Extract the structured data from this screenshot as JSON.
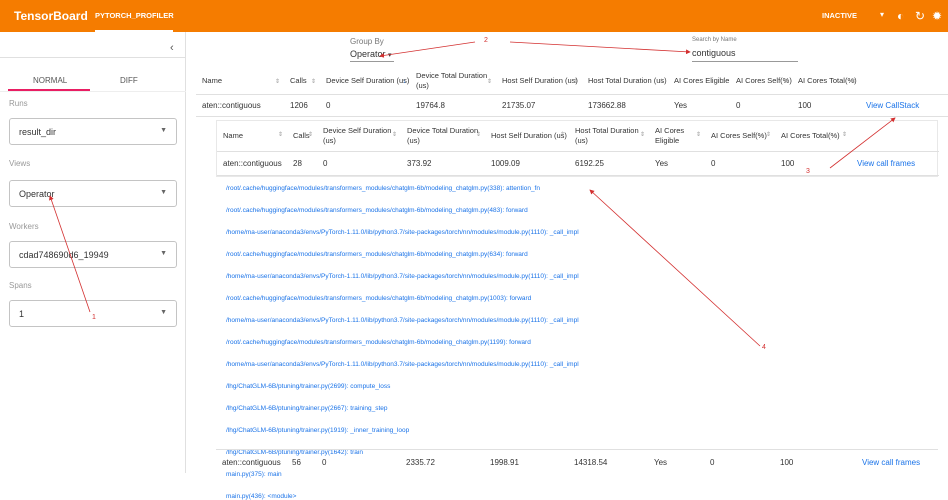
{
  "topbar": {
    "brand": "TensorBoard",
    "active_tab": "PYTORCH_PROFILER",
    "status": "INACTIVE",
    "icons": [
      "dropdown-caret-icon",
      "theme-toggle-icon",
      "refresh-icon",
      "settings-icon"
    ],
    "accent_color": "#f57c00"
  },
  "sidebar": {
    "modes": [
      "NORMAL",
      "DIFF"
    ],
    "runs_label": "Runs",
    "run_value": "result_dir",
    "views_label": "Views",
    "view_value": "Operator",
    "workers_label": "Workers",
    "worker_value": "cdad748690d6_19949",
    "spans_label": "Spans",
    "span_value": "1"
  },
  "toolbar": {
    "group_by_label": "Group By",
    "group_by_value": "Operator",
    "search_label": "Search by Name",
    "search_value": "contiguous"
  },
  "table": {
    "headers": [
      "Name",
      "Calls",
      "Device Self Duration (us)",
      "Device Total Duration (us)",
      "Host Self Duration (us)",
      "Host Total Duration (us)",
      "AI Cores Eligible",
      "AI Cores Self(%)",
      "AI Cores Total(%)"
    ],
    "row": {
      "name": "aten::contiguous",
      "calls": "1206",
      "device_self": "0",
      "device_total": "19764.8",
      "host_self": "21735.07",
      "host_total": "173662.88",
      "eligible": "Yes",
      "self_pct": "0",
      "total_pct": "100",
      "action": "View CallStack"
    }
  },
  "inner_table": {
    "rows": [
      {
        "name": "aten::contiguous",
        "calls": "28",
        "device_self": "0",
        "device_total": "373.92",
        "host_self": "1009.09",
        "host_total": "6192.25",
        "eligible": "Yes",
        "self_pct": "0",
        "total_pct": "100",
        "action": "View call frames"
      },
      {
        "name": "aten::contiguous",
        "calls": "56",
        "device_self": "0",
        "device_total": "2335.72",
        "host_self": "1998.91",
        "host_total": "14318.54",
        "eligible": "Yes",
        "self_pct": "0",
        "total_pct": "100",
        "action": "View call frames"
      }
    ],
    "frames": [
      "/root/.cache/huggingface/modules/transformers_modules/chatglm-6b/modeling_chatglm.py(338): attention_fn",
      "/root/.cache/huggingface/modules/transformers_modules/chatglm-6b/modeling_chatglm.py(483): forward",
      "/home/ma-user/anaconda3/envs/PyTorch-1.11.0/lib/python3.7/site-packages/torch/nn/modules/module.py(1110): _call_impl",
      "/root/.cache/huggingface/modules/transformers_modules/chatglm-6b/modeling_chatglm.py(634): forward",
      "/home/ma-user/anaconda3/envs/PyTorch-1.11.0/lib/python3.7/site-packages/torch/nn/modules/module.py(1110): _call_impl",
      "/root/.cache/huggingface/modules/transformers_modules/chatglm-6b/modeling_chatglm.py(1003): forward",
      "/home/ma-user/anaconda3/envs/PyTorch-1.11.0/lib/python3.7/site-packages/torch/nn/modules/module.py(1110): _call_impl",
      "/root/.cache/huggingface/modules/transformers_modules/chatglm-6b/modeling_chatglm.py(1199): forward",
      "/home/ma-user/anaconda3/envs/PyTorch-1.11.0/lib/python3.7/site-packages/torch/nn/modules/module.py(1110): _call_impl",
      "/lhg/ChatGLM-6B/ptuning/trainer.py(2699): compute_loss",
      "/lhg/ChatGLM-6B/ptuning/trainer.py(2667): training_step",
      "/lhg/ChatGLM-6B/ptuning/trainer.py(1919): _inner_training_loop",
      "/lhg/ChatGLM-6B/ptuning/trainer.py(1642): train",
      "main.py(375): main",
      "main.py(436): <module>"
    ]
  },
  "annotations": [
    "1",
    "2",
    "3",
    "4"
  ]
}
